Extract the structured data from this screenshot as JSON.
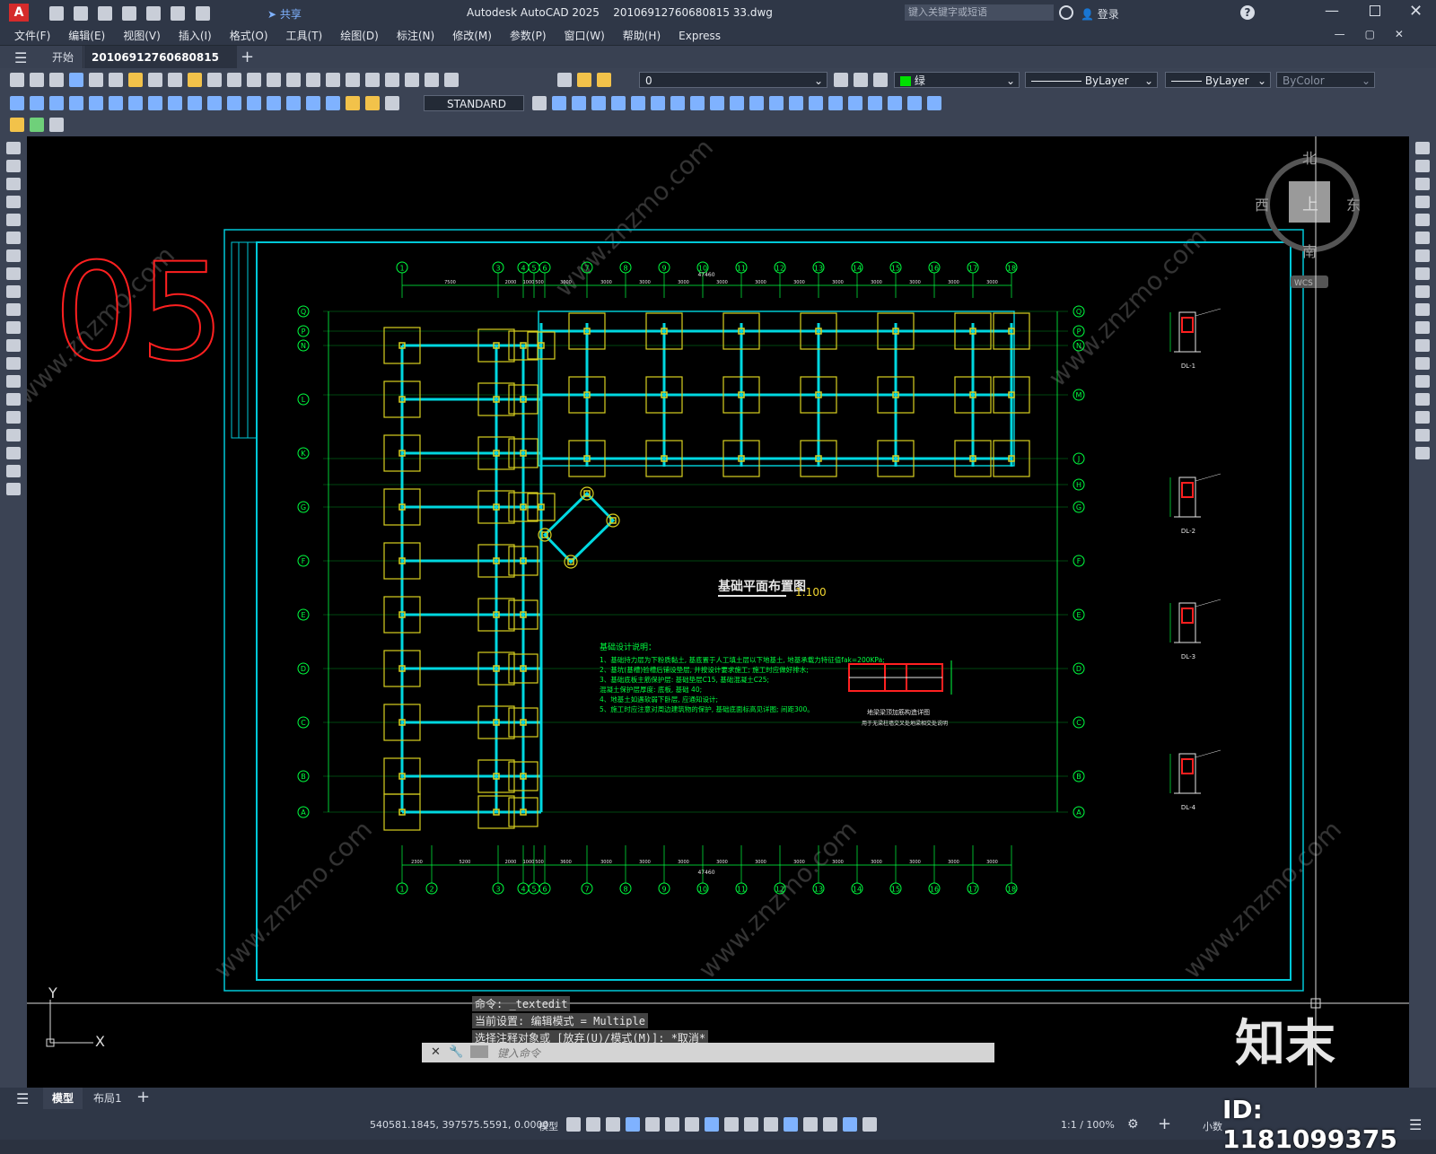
{
  "app": {
    "title": "Autodesk AutoCAD 2025",
    "filename": "20106912760680815 33.dwg",
    "share_label": "共享",
    "search_placeholder": "键入关键字或短语",
    "login_label": "登录"
  },
  "menu": [
    "文件(F)",
    "编辑(E)",
    "视图(V)",
    "插入(I)",
    "格式(O)",
    "工具(T)",
    "绘图(D)",
    "标注(N)",
    "修改(M)",
    "参数(P)",
    "窗口(W)",
    "帮助(H)",
    "Express"
  ],
  "tabs": {
    "start": "开始",
    "doc": "20106912760680815 33*"
  },
  "props": {
    "layer": "0",
    "color": "绿",
    "linetype": "ByLayer",
    "lineweight": "ByLayer",
    "plotstyle": "ByColor",
    "textstyle": "STANDARD"
  },
  "viewcube": {
    "north": "北",
    "south": "南",
    "east": "东",
    "west": "西",
    "top": "上",
    "wcs": "WCS"
  },
  "drawing": {
    "big_number": "05",
    "title": "基础平面布置图",
    "scale": "1:100",
    "notes_title": "基础设计说明：",
    "notes": [
      "1、基础持力层为下粉质黏土, 基底置于人工填土层以下地基土, 地基承载力特征值fak=200KPa;",
      "2、基坑(基槽)验槽后铺设垫层, 并按设计要求施工; 施工时应做好排水;",
      "3、基础底板主筋保护层: 基础垫层C15, 基础混凝土C25;",
      "   混凝土保护层厚度: 底板, 基础 40;",
      "4、地基土如遇软弱下卧层, 应通知设计;",
      "5、施工时应注意对周边建筑物的保护, 基础底面标高见详图; 间距300。"
    ],
    "detail_caption": "地梁梁顶加筋构造详图",
    "detail_sub": "用于无梁柱墙交叉处地梁相交处说明",
    "total_dim": "47460",
    "sections": [
      "DL-1",
      "DL-2",
      "DL-3",
      "DL-4"
    ],
    "top_axes": [
      "1",
      "3",
      "4",
      "5",
      "6",
      "7",
      "8",
      "9",
      "10",
      "11",
      "12",
      "13",
      "14",
      "15",
      "16",
      "17",
      "18"
    ],
    "bottom_axes": [
      "1",
      "2",
      "3",
      "4",
      "5",
      "6",
      "7",
      "8",
      "9",
      "10",
      "11",
      "12",
      "13",
      "14",
      "15",
      "16",
      "17",
      "18"
    ],
    "left_axes": [
      "Q",
      "P",
      "N",
      "L",
      "K",
      "G",
      "F",
      "E",
      "D",
      "C",
      "B",
      "A"
    ],
    "right_axes": [
      "Q",
      "P",
      "N",
      "M",
      "J",
      "H",
      "G",
      "F",
      "E",
      "D",
      "C",
      "B",
      "A"
    ],
    "top_dims": [
      "7500",
      "2000",
      "1000",
      "500",
      "3000",
      "3000",
      "3000",
      "3000",
      "3000",
      "3000",
      "3000",
      "3000",
      "3000",
      "3000",
      "3000",
      "3000"
    ],
    "bottom_dims": [
      "2300",
      "5200",
      "2000",
      "1000",
      "500",
      "3600",
      "3000",
      "3000",
      "3000",
      "3000",
      "3000",
      "3000",
      "3000",
      "3000",
      "3000",
      "3000",
      "3000"
    ]
  },
  "commandline": {
    "history": [
      "命令: _textedit",
      "当前设置: 编辑模式 = Multiple",
      "选择注释对象或 [放弃(U)/模式(M)]: *取消*"
    ],
    "placeholder": "键入命令"
  },
  "layout_tabs": [
    "模型",
    "布局1"
  ],
  "status": {
    "coords": "540581.1845, 397575.5591, 0.0000",
    "mode": "模型",
    "scale": "1:1 / 100%",
    "units": "小数"
  },
  "watermark": {
    "brand": "知末",
    "id": "ID: 1181099375"
  },
  "colors": {
    "canvas": "#000000",
    "frame": "#00c8d8",
    "axis": "#00ff40",
    "footing": "#d8d020",
    "beam": "#00d8e0",
    "title": "#ff2020"
  }
}
